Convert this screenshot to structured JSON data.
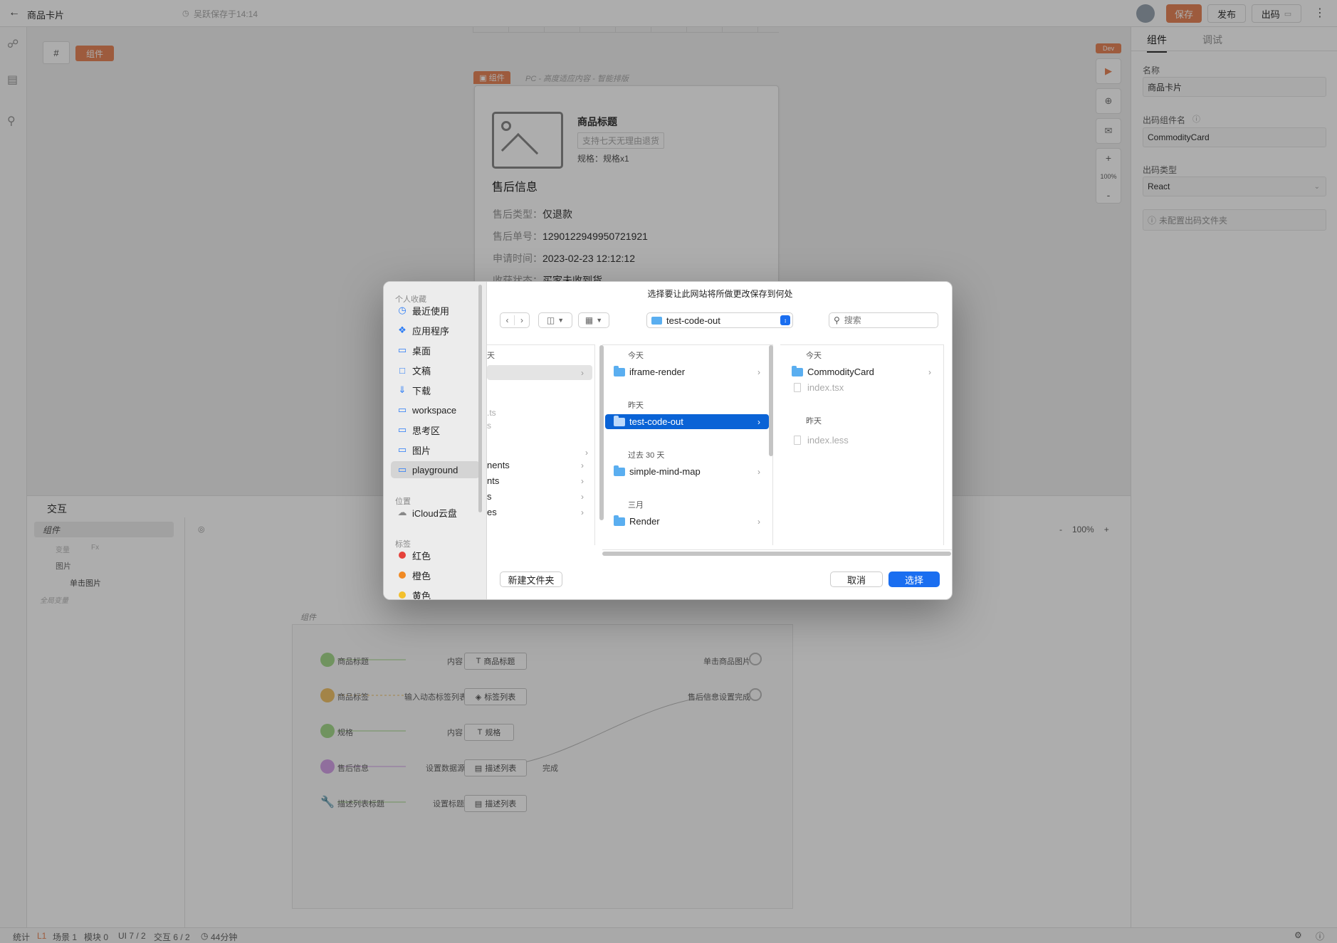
{
  "topbar": {
    "back_icon": "arrow-left-icon",
    "title": "商品卡片",
    "save_status": "吴跃保存于14:14",
    "save_btn": "保存",
    "publish_btn": "发布",
    "code_btn": "出码",
    "accent": "#e8875a"
  },
  "canvas": {
    "tag_hash": "#",
    "tag_component": "组件",
    "card_badge": "组件",
    "card_badge_desc": "PC - 高度适应内容 - 智能排版",
    "product_title": "商品标题",
    "product_tag": "支持七天无理由退货",
    "spec_text": "规格：规格x1",
    "section_title": "售后信息",
    "rows": [
      {
        "k": "售后类型：",
        "v": "仅退款"
      },
      {
        "k": "售后单号：",
        "v": "1290122949950721921"
      },
      {
        "k": "申请时间：",
        "v": "2023-02-23 12:12:12"
      },
      {
        "k": "收获状态：",
        "v": "买家未收到货"
      }
    ],
    "dev_badge": "Dev",
    "zoom_plus": "+",
    "zoom_value": "100%",
    "zoom_minus": "-"
  },
  "right_panel": {
    "tabs": [
      "组件",
      "调试"
    ],
    "name_label": "名称",
    "name_value": "商品卡片",
    "code_name_label": "出码组件名",
    "code_name_value": "CommodityCard",
    "code_type_label": "出码类型",
    "code_type_value": "React",
    "folder_btn": "未配置出码文件夹"
  },
  "bottom": {
    "title": "交互",
    "tree": [
      "组件",
      "变量",
      "Fx",
      "图片",
      "单击图片",
      "全局变量"
    ],
    "zoom_minus": "-",
    "zoom_value": "100%",
    "zoom_plus": "+",
    "flow_title": "组件",
    "flow": [
      {
        "left": "商品标题",
        "mid": "内容",
        "node": "商品标题",
        "color": "#a6d98c"
      },
      {
        "left": "商品标签",
        "mid": "输入动态标签列表",
        "node": "标签列表",
        "color": "#f0c36b"
      },
      {
        "left": "规格",
        "mid": "内容",
        "node": "规格",
        "color": "#a6d98c"
      },
      {
        "left": "售后信息",
        "mid": "设置数据源",
        "node": "描述列表",
        "out": "完成",
        "color": "#d4a2e8"
      },
      {
        "left": "描述列表标题",
        "mid": "设置标题",
        "node": "描述列表",
        "color": "#7fb84a"
      }
    ],
    "outputs": [
      "单击商品图片",
      "售后信息设置完成"
    ]
  },
  "statusbar": {
    "stats": "统计",
    "level": "L1",
    "scene": "场景 1",
    "module": "模块 0",
    "ui": "UI 7 / 2",
    "interact": "交互 6 / 2",
    "time": "44分钟"
  },
  "dialog": {
    "title": "选择要让此网站将所做更改保存到何处",
    "favorites_head": "个人收藏",
    "favorites": [
      {
        "icon": "clock-icon",
        "label": "最近使用"
      },
      {
        "icon": "apps-icon",
        "label": "应用程序"
      },
      {
        "icon": "desktop-icon",
        "label": "桌面"
      },
      {
        "icon": "document-icon",
        "label": "文稿"
      },
      {
        "icon": "download-icon",
        "label": "下载"
      },
      {
        "icon": "folder-icon",
        "label": "workspace"
      },
      {
        "icon": "folder-icon",
        "label": "思考区"
      },
      {
        "icon": "folder-icon",
        "label": "图片"
      },
      {
        "icon": "folder-icon",
        "label": "playground"
      }
    ],
    "locations_head": "位置",
    "icloud": "iCloud云盘",
    "tags_head": "标签",
    "tags": [
      {
        "label": "红色",
        "color": "#e5423b"
      },
      {
        "label": "橙色",
        "color": "#f08a24"
      },
      {
        "label": "黄色",
        "color": "#f3c02d"
      }
    ],
    "location_select": "test-code-out",
    "search_placeholder": "搜索",
    "col1_head": "天",
    "col1_items": [
      ".ts",
      "s",
      "nents",
      "nts",
      "s",
      "es"
    ],
    "col2": {
      "today": "今天",
      "iframe": "iframe-render",
      "yesterday": "昨天",
      "test_code_out": "test-code-out",
      "past30": "过去 30 天",
      "mindmap": "simple-mind-map",
      "march": "三月",
      "render": "Render"
    },
    "col3": {
      "today": "今天",
      "commodity": "CommodityCard",
      "index_tsx": "index.tsx",
      "yesterday": "昨天",
      "index_less": "index.less"
    },
    "new_folder": "新建文件夹",
    "cancel": "取消",
    "choose": "选择",
    "accent": "#1a6ef0"
  }
}
